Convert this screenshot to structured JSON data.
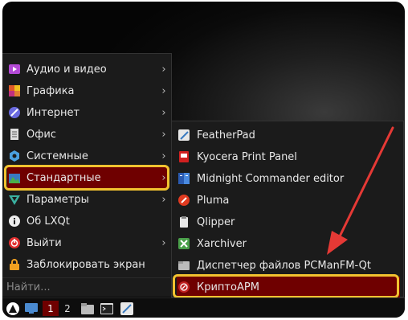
{
  "main_menu": {
    "items": [
      {
        "label": "Аудио и видео",
        "icon": "multimedia-icon",
        "color": "#b44ad6"
      },
      {
        "label": "Графика",
        "icon": "graphics-icon",
        "color": "#e05a2a"
      },
      {
        "label": "Интернет",
        "icon": "internet-icon",
        "color": "#6a6ae0"
      },
      {
        "label": "Офис",
        "icon": "office-icon",
        "color": "#dddddd"
      },
      {
        "label": "Системные",
        "icon": "system-icon",
        "color": "#4aa0e0"
      },
      {
        "label": "Стандартные",
        "icon": "accessories-icon",
        "color": "#4ab04a"
      },
      {
        "label": "Параметры",
        "icon": "settings-icon",
        "color": "#3ab0a0"
      },
      {
        "label": "Об LXQt",
        "icon": "about-icon",
        "color": "#eeeeee"
      },
      {
        "label": "Выйти",
        "icon": "logout-icon",
        "color": "#e03030"
      },
      {
        "label": "Заблокировать экран",
        "icon": "lock-icon",
        "color": "#f0a020"
      }
    ],
    "search_placeholder": "Найти..."
  },
  "submenu": {
    "items": [
      {
        "label": "FeatherPad",
        "icon": "featherpad-icon"
      },
      {
        "label": "Kyocera Print Panel",
        "icon": "kyocera-icon"
      },
      {
        "label": "Midnight Commander editor",
        "icon": "mc-icon"
      },
      {
        "label": "Pluma",
        "icon": "pluma-icon"
      },
      {
        "label": "Qlipper",
        "icon": "qlipper-icon"
      },
      {
        "label": "Xarchiver",
        "icon": "xarchiver-icon"
      },
      {
        "label": "Диспетчер файлов PCManFM-Qt",
        "icon": "file-manager-icon"
      },
      {
        "label": "КриптоАРМ",
        "icon": "cryptoarm-icon"
      }
    ]
  },
  "taskbar": {
    "desktop_1": "1",
    "desktop_2": "2"
  },
  "colors": {
    "selection": "#6f0000",
    "highlight": "#f2c230",
    "arrow": "#e53935"
  }
}
